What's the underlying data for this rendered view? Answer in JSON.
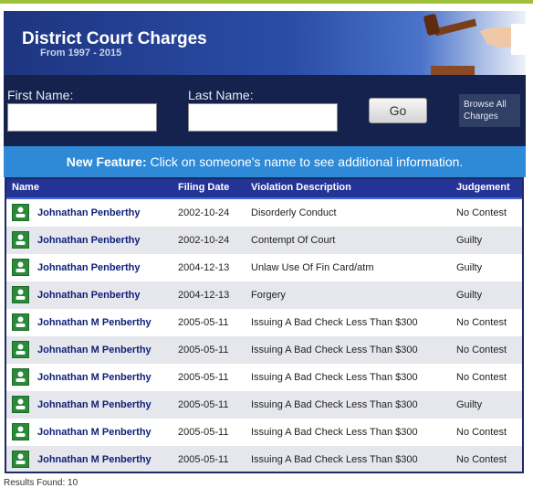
{
  "header": {
    "title": "District Court Charges",
    "subtitle": "From 1997 - 2015"
  },
  "search": {
    "first_name_label": "First Name:",
    "last_name_label": "Last Name:",
    "first_name_value": "",
    "last_name_value": "",
    "go_label": "Go",
    "browse_line1": "Browse All",
    "browse_line2": "Charges"
  },
  "feature": {
    "bold": "New Feature:",
    "text": " Click on someone's name to see additional information."
  },
  "table": {
    "columns": [
      "Name",
      "Filing Date",
      "Violation Description",
      "Judgement"
    ],
    "rows": [
      {
        "name": "Johnathan Penberthy",
        "date": "2002-10-24",
        "violation": "Disorderly Conduct",
        "judgement": "No Contest"
      },
      {
        "name": "Johnathan Penberthy",
        "date": "2002-10-24",
        "violation": "Contempt Of Court",
        "judgement": "Guilty"
      },
      {
        "name": "Johnathan Penberthy",
        "date": "2004-12-13",
        "violation": "Unlaw Use Of Fin Card/atm",
        "judgement": "Guilty"
      },
      {
        "name": "Johnathan Penberthy",
        "date": "2004-12-13",
        "violation": "Forgery",
        "judgement": "Guilty"
      },
      {
        "name": "Johnathan M Penberthy",
        "date": "2005-05-11",
        "violation": "Issuing A Bad Check Less Than $300",
        "judgement": "No Contest"
      },
      {
        "name": "Johnathan M Penberthy",
        "date": "2005-05-11",
        "violation": "Issuing A Bad Check Less Than $300",
        "judgement": "No Contest"
      },
      {
        "name": "Johnathan M Penberthy",
        "date": "2005-05-11",
        "violation": "Issuing A Bad Check Less Than $300",
        "judgement": "No Contest"
      },
      {
        "name": "Johnathan M Penberthy",
        "date": "2005-05-11",
        "violation": "Issuing A Bad Check Less Than $300",
        "judgement": "Guilty"
      },
      {
        "name": "Johnathan M Penberthy",
        "date": "2005-05-11",
        "violation": "Issuing A Bad Check Less Than $300",
        "judgement": "No Contest"
      },
      {
        "name": "Johnathan M Penberthy",
        "date": "2005-05-11",
        "violation": "Issuing A Bad Check Less Than $300",
        "judgement": "No Contest"
      }
    ]
  },
  "footer": {
    "results_text": "Results Found: 10"
  },
  "icons": {
    "row_icon": "person-icon",
    "header_image": "gavel-icon"
  },
  "colors": {
    "header_bg": "#1e3580",
    "search_bg": "#15224e",
    "feature_bg": "#2e8ad6",
    "table_header_bg": "#243496",
    "name_link": "#0e1f7a",
    "icon_green": "#2a8a3a"
  }
}
